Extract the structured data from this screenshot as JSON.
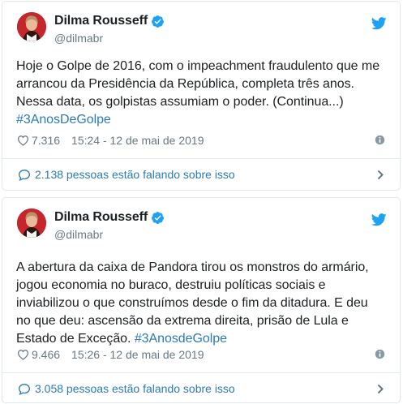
{
  "tweets": [
    {
      "author_name": "Dilma Rousseff",
      "author_handle": "@dilmabr",
      "lines": [
        "Hoje o Golpe de 2016, com o impeachment fraudulento que me",
        "arrancou da Presidência da República, completa três anos.",
        "Nessa data, os golpistas assumiam o poder. (Continua...)"
      ],
      "hashtag_line": "#3AnosDeGolpe",
      "likes": "7.316",
      "timestamp": "15:24 - 12 de mai de 2019",
      "conversation": "2.138 pessoas estão falando sobre isso"
    },
    {
      "author_name": "Dilma Rousseff",
      "author_handle": "@dilmabr",
      "lines": [
        "A abertura da caixa de Pandora tirou os monstros do armário,",
        "jogou economia no buraco, destruiu políticas sociais e",
        "inviabilizou o que construímos desde o fim da ditadura. E deu",
        "no que deu: ascensão da extrema direita, prisão de Lula e"
      ],
      "last_line_text": "Estado de Exceção. ",
      "hashtag_inline": "#3AnosdeGolpe",
      "likes": "9.466",
      "timestamp": "15:26 - 12 de mai de 2019",
      "conversation": "3.058 pessoas estão falando sobre isso"
    }
  ],
  "icons": {
    "verified": "verified-badge-icon",
    "twitter": "twitter-bird-icon",
    "like": "heart-icon",
    "info": "info-icon",
    "reply": "speech-bubble-icon",
    "open": "chevron-right-icon"
  },
  "colors": {
    "link": "#2b7bb9",
    "twitter_blue": "#1da1f2",
    "text": "#1c2022",
    "secondary": "#697882",
    "border": "#e1e8ed"
  }
}
